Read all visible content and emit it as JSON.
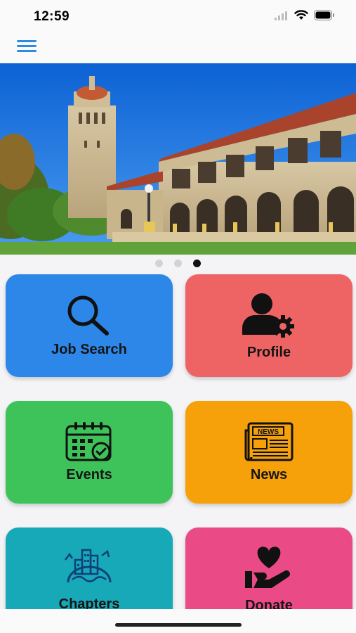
{
  "status_bar": {
    "time": "12:59",
    "icons": [
      "signal-icon",
      "wifi-icon",
      "battery-icon"
    ]
  },
  "header": {
    "menu_icon": "hamburger-menu-icon"
  },
  "carousel": {
    "slide_count": 3,
    "active_index": 2
  },
  "tiles": [
    {
      "label": "Job Search",
      "icon": "magnifier-icon",
      "color": "#2d87e9"
    },
    {
      "label": "Profile",
      "icon": "user-gear-icon",
      "color": "#ee6464"
    },
    {
      "label": "Events",
      "icon": "calendar-check-icon",
      "color": "#3ec35b"
    },
    {
      "label": "News",
      "icon": "newspaper-icon",
      "color": "#f6a10a"
    },
    {
      "label": "Chapters",
      "icon": "globe-buildings-icon",
      "color": "#17a9b7"
    },
    {
      "label": "Donate",
      "icon": "heart-hand-icon",
      "color": "#ea4a86"
    }
  ]
}
